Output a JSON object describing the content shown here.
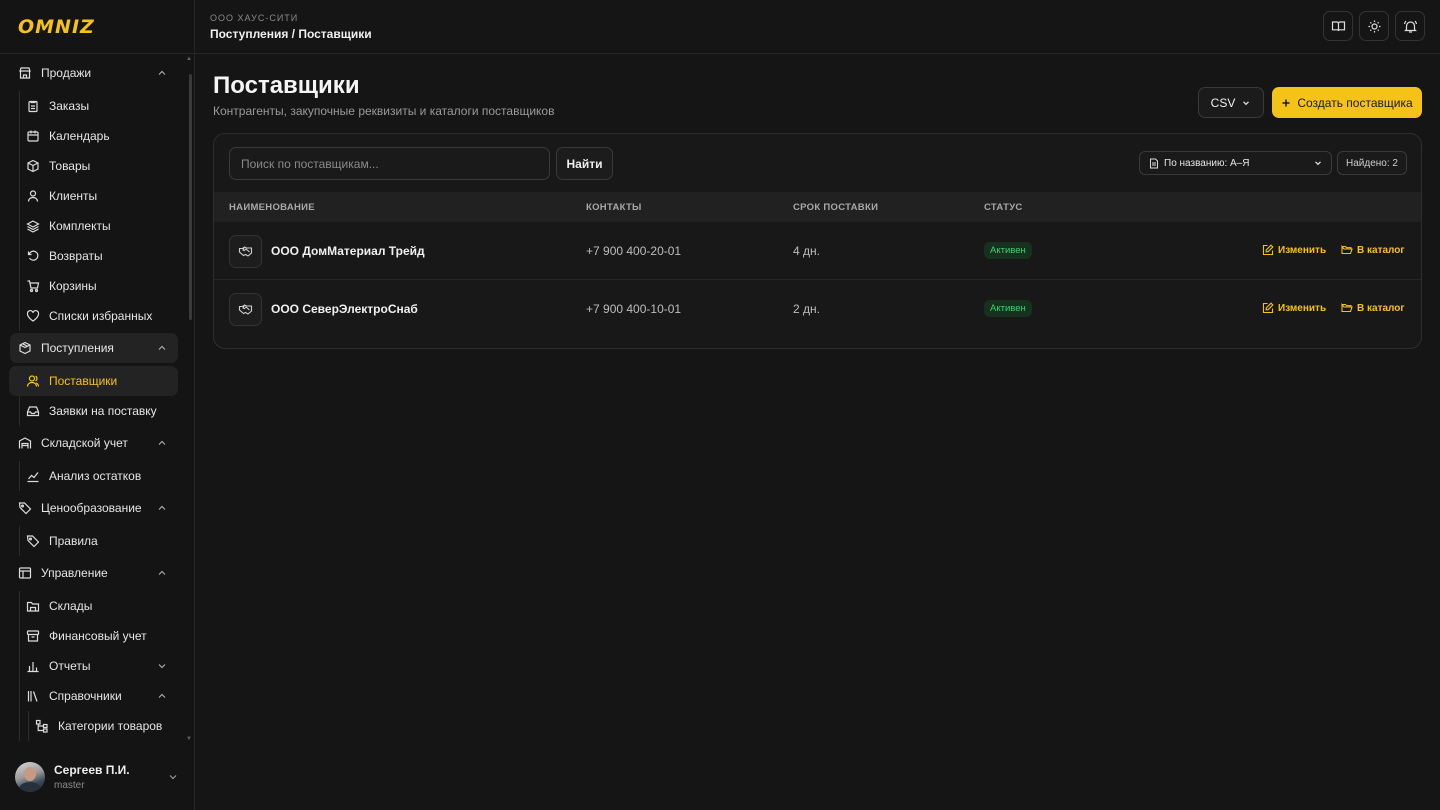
{
  "app": {
    "logo": "OMNIZ"
  },
  "topbar": {
    "org": "ООО ХАУС-СИТИ",
    "breadcrumb": "Поступления / Поставщики"
  },
  "sidebar": {
    "groups": [
      {
        "label": "Продажи",
        "items": [
          "Заказы",
          "Календарь",
          "Товары",
          "Клиенты",
          "Комплекты",
          "Возвраты",
          "Корзины",
          "Списки избранных"
        ]
      },
      {
        "label": "Поступления",
        "items": [
          "Поставщики",
          "Заявки на поставку"
        ]
      },
      {
        "label": "Складской учет",
        "items": [
          "Анализ остатков"
        ]
      },
      {
        "label": "Ценообразование",
        "items": [
          "Правила"
        ]
      },
      {
        "label": "Управление",
        "items": [
          "Склады",
          "Финансовый учет",
          "Отчеты",
          "Справочники"
        ],
        "subitems": [
          "Категории товаров"
        ]
      }
    ],
    "active_item": "Поставщики"
  },
  "user": {
    "name": "Сергеев П.И.",
    "role": "master"
  },
  "page": {
    "title": "Поставщики",
    "subtitle": "Контрагенты, закупочные реквизиты и каталоги поставщиков",
    "csv_label": "CSV",
    "create_label": "Создать поставщика"
  },
  "toolbar": {
    "search_placeholder": "Поиск по поставщикам...",
    "find_label": "Найти",
    "sort_label": "По названию: А–Я",
    "found_label": "Найдено: 2"
  },
  "table": {
    "columns": [
      "НАИМЕНОВАНИЕ",
      "КОНТАКТЫ",
      "СРОК ПОСТАВКИ",
      "СТАТУС"
    ],
    "rows": [
      {
        "name": "ООО ДомМатериал Трейд",
        "phone": "+7 900 400-20-01",
        "term": "4 дн.",
        "status": "Активен",
        "edit": "Изменить",
        "catalog": "В каталог"
      },
      {
        "name": "ООО СеверЭлектроСнаб",
        "phone": "+7 900 400-10-01",
        "term": "2 дн.",
        "status": "Активен",
        "edit": "Изменить",
        "catalog": "В каталог"
      }
    ]
  },
  "colors": {
    "accent": "#f5c218",
    "status_active": "#3fcf70",
    "background": "#151515"
  }
}
